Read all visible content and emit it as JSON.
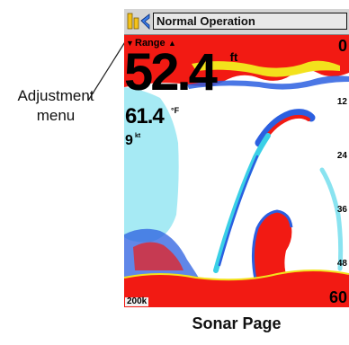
{
  "callout": {
    "label_line1": "Adjustment",
    "label_line2": "menu"
  },
  "title_bar": {
    "title": "Normal Operation",
    "menu_icon": "adjustment-menu-icon"
  },
  "readouts": {
    "range_label": "Range",
    "range_down_arrow": "▼",
    "range_up_arrow": "▲",
    "depth": "52.4",
    "depth_unit": "ft",
    "water_temp": "61.4",
    "water_temp_unit": "°F",
    "speed": "9",
    "speed_unit": "kt"
  },
  "depth_scale": {
    "top": "0",
    "ticks": [
      "12",
      "24",
      "36",
      "48"
    ],
    "bottom": "60"
  },
  "zoom_label": "200k",
  "caption": "Sonar Page",
  "colors": {
    "sonar_red": "#f21a13",
    "sonar_blue": "#2b5fe0",
    "sonar_cyan": "#3ad0e6",
    "sonar_yellow": "#f3e21c",
    "background_white": "#ffffff"
  }
}
